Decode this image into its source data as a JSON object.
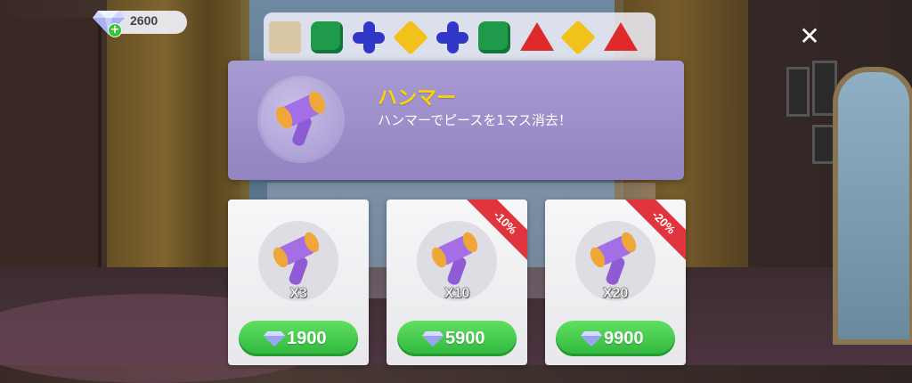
{
  "currency": {
    "amount": "2600"
  },
  "close_label": "✕",
  "board": {
    "top_row": [
      "box",
      "green",
      "blue",
      "yellow",
      "blue",
      "green",
      "red",
      "yellow",
      "red"
    ]
  },
  "item": {
    "name": "ハンマー",
    "description": "ハンマーでピースを1マス消去！"
  },
  "offers": [
    {
      "quantity": "X3",
      "price": "1900",
      "discount": ""
    },
    {
      "quantity": "X10",
      "price": "5900",
      "discount": "-10%"
    },
    {
      "quantity": "X20",
      "price": "9900",
      "discount": "-20%"
    }
  ],
  "colors": {
    "panel": "#9a8cc8",
    "title": "#ffd400",
    "buy_button": "#3ec447",
    "ribbon": "#e0353e"
  },
  "icons": {
    "currency": "diamond-gem-icon",
    "item": "hammer-icon",
    "close": "close-icon"
  }
}
